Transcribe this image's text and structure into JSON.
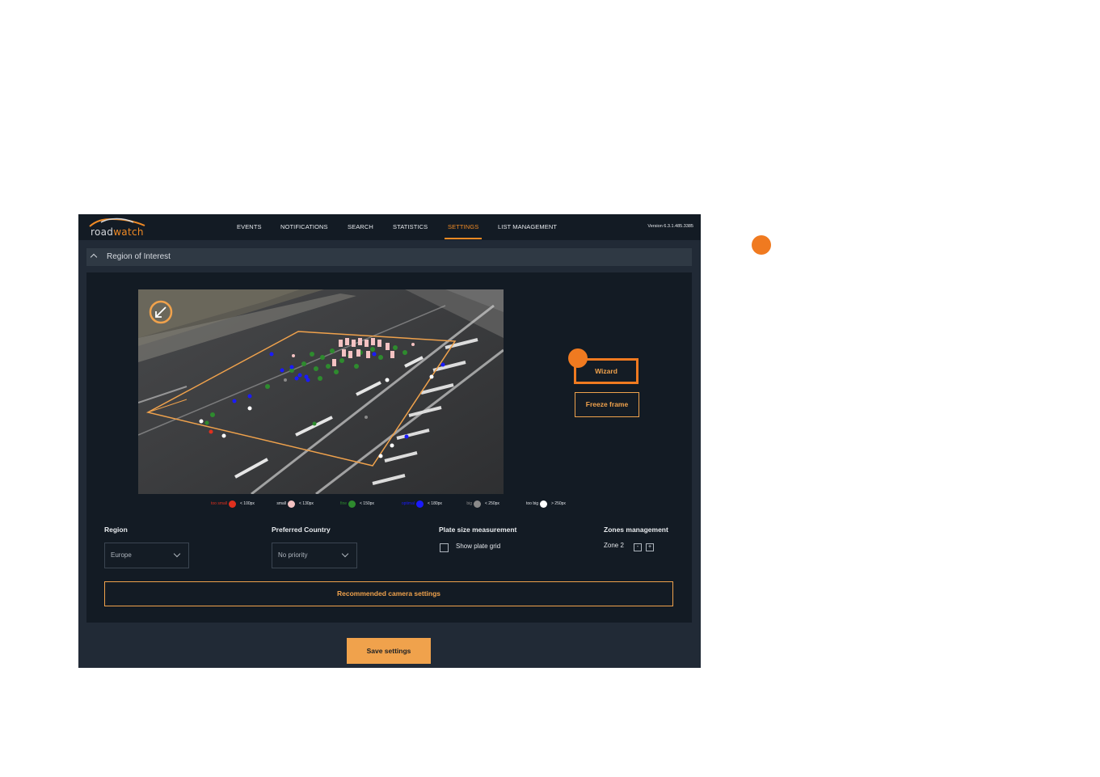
{
  "app": {
    "brand": {
      "prefix": "road",
      "suffix": "watch"
    },
    "version": "Version 6.3.1.485.3385",
    "nav": [
      {
        "label": "EVENTS",
        "active": false
      },
      {
        "label": "NOTIFICATIONS",
        "active": false
      },
      {
        "label": "SEARCH",
        "active": false
      },
      {
        "label": "STATISTICS",
        "active": false
      },
      {
        "label": "SETTINGS",
        "active": true
      },
      {
        "label": "LIST MANAGEMENT",
        "active": false
      }
    ]
  },
  "section": {
    "title": "Region of Interest",
    "icon": "chevron-up-icon"
  },
  "camera": {
    "overlay_icon": "collapse-arrow-icon"
  },
  "actions": {
    "wizard": "Wizard",
    "freeze_frame": "Freeze frame"
  },
  "legend": [
    {
      "name": "too small",
      "range": "< 100px",
      "color": "#e0301e"
    },
    {
      "name": "small",
      "range": "< 130px",
      "color": "#f4c2c2"
    },
    {
      "name": "fine",
      "range": "< 150px",
      "color": "#2e8b2e"
    },
    {
      "name": "optimal",
      "range": "< 180px",
      "color": "#1a1aff"
    },
    {
      "name": "big",
      "range": "< 250px",
      "color": "#8a8a8a"
    },
    {
      "name": "too big",
      "range": "> 250px",
      "color": "#ffffff"
    }
  ],
  "fields": {
    "region": {
      "label": "Region",
      "value": "Europe"
    },
    "country": {
      "label": "Preferred Country",
      "value": "No priority"
    },
    "plate": {
      "label": "Plate size measurement",
      "checkbox_label": "Show plate grid",
      "checked": false
    },
    "zones": {
      "label": "Zones management",
      "zone": "Zone 2",
      "minus": "-",
      "plus": "+"
    }
  },
  "buttons": {
    "recommended": "Recommended camera settings",
    "save": "Save settings"
  },
  "colors": {
    "accent": "#f0a24c",
    "marker": "#f07a20",
    "background": "#212a36",
    "panel": "#131b24"
  }
}
